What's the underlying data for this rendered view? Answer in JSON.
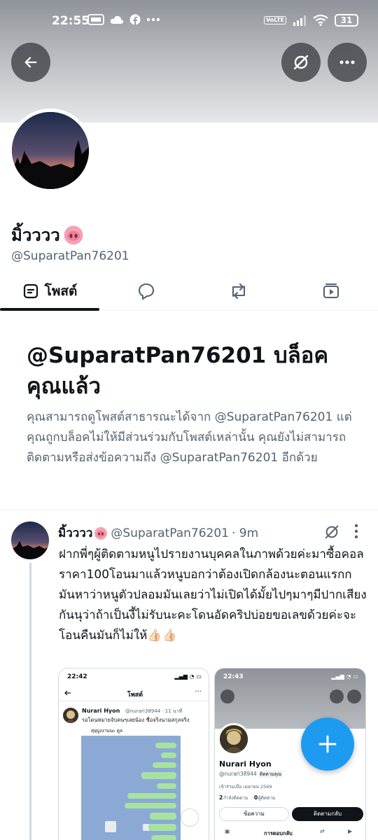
{
  "status_bar": {
    "time": "22:55",
    "badges": [
      "VoLTE"
    ],
    "battery": "31"
  },
  "profile": {
    "name": "มิ้วววว",
    "handle": "@SuparatPan76201"
  },
  "tabs": [
    {
      "label": "โพสต์",
      "active": true
    }
  ],
  "blocked": {
    "title": "@SuparatPan76201 บล็อคคุณแล้ว",
    "description": "คุณสามารถดูโพสต์สาธารณะได้จาก @SuparatPan76201 แต่คุณถูกบล็อคไม่ให้มีส่วนร่วมกับโพสต์เหล่านั้น คุณยังไม่สามารถติดตามหรือส่งข้อความถึง @SuparatPan76201 อีกด้วย"
  },
  "post": {
    "name": "มิ้วววว",
    "handle": "@SuparatPan76201",
    "time": "· 9m",
    "text": "ฝากพี่ๆผู้ติดตามหนูไปรายงานบุคคลในภาพด้วยค่ะมาซื้อคอลราคา100โอนมาแล้วหนูบอกว่าต้องเปิดกล้องนะตอนแรกกมันหาว่าหนูตัวปลอมมันเลยว่าไม่เปิดได้มั้ยไปๆมาๆมีปากเสียงกันนุว่าถ้าเป็นงี้ไม่รับนะคะโดนอัดคริปบ่อยขอเลขด้วยค่ะจะโอนคืนมันก็ไม่ให้👍🏻👍🏻",
    "media_left": {
      "time": "22:42",
      "header": "โพสต์",
      "poster_name": "Nurari Hyon",
      "poster_meta": "@nurari38944 · 11 นาที",
      "poster_text": "รอโดนหมายจับคนๆเลยน้อง ชื่อจริงนามสกุลจริง",
      "chat_title": "คุ่ยุบูงงานนะ ดูล"
    },
    "media_right": {
      "time": "22:43",
      "name": "Nurari Hyon",
      "handle": "@nurari38944",
      "follows_badge": "ติดตามคุณ",
      "joined": "เข้าร่วมเมื่อ เมษายน 2569",
      "following_count": "2",
      "following_label": "กำลังติดตาม",
      "followers_count": "0",
      "followers_label": "ผู้ติดตาม",
      "message_btn": "ข้อความ",
      "follow_back_btn": "ติดตามกลับ",
      "replies_tab": "การตอบกลับ"
    }
  },
  "colors": {
    "accent": "#1d9bf0",
    "text": "#0f1419",
    "muted": "#536471"
  }
}
